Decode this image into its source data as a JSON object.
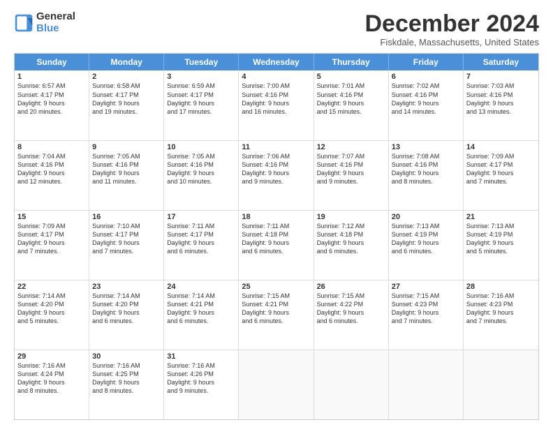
{
  "logo": {
    "general": "General",
    "blue": "Blue"
  },
  "title": "December 2024",
  "location": "Fiskdale, Massachusetts, United States",
  "headers": [
    "Sunday",
    "Monday",
    "Tuesday",
    "Wednesday",
    "Thursday",
    "Friday",
    "Saturday"
  ],
  "weeks": [
    [
      {
        "day": "1",
        "lines": [
          "Sunrise: 6:57 AM",
          "Sunset: 4:17 PM",
          "Daylight: 9 hours",
          "and 20 minutes."
        ]
      },
      {
        "day": "2",
        "lines": [
          "Sunrise: 6:58 AM",
          "Sunset: 4:17 PM",
          "Daylight: 9 hours",
          "and 19 minutes."
        ]
      },
      {
        "day": "3",
        "lines": [
          "Sunrise: 6:59 AM",
          "Sunset: 4:17 PM",
          "Daylight: 9 hours",
          "and 17 minutes."
        ]
      },
      {
        "day": "4",
        "lines": [
          "Sunrise: 7:00 AM",
          "Sunset: 4:16 PM",
          "Daylight: 9 hours",
          "and 16 minutes."
        ]
      },
      {
        "day": "5",
        "lines": [
          "Sunrise: 7:01 AM",
          "Sunset: 4:16 PM",
          "Daylight: 9 hours",
          "and 15 minutes."
        ]
      },
      {
        "day": "6",
        "lines": [
          "Sunrise: 7:02 AM",
          "Sunset: 4:16 PM",
          "Daylight: 9 hours",
          "and 14 minutes."
        ]
      },
      {
        "day": "7",
        "lines": [
          "Sunrise: 7:03 AM",
          "Sunset: 4:16 PM",
          "Daylight: 9 hours",
          "and 13 minutes."
        ]
      }
    ],
    [
      {
        "day": "8",
        "lines": [
          "Sunrise: 7:04 AM",
          "Sunset: 4:16 PM",
          "Daylight: 9 hours",
          "and 12 minutes."
        ]
      },
      {
        "day": "9",
        "lines": [
          "Sunrise: 7:05 AM",
          "Sunset: 4:16 PM",
          "Daylight: 9 hours",
          "and 11 minutes."
        ]
      },
      {
        "day": "10",
        "lines": [
          "Sunrise: 7:05 AM",
          "Sunset: 4:16 PM",
          "Daylight: 9 hours",
          "and 10 minutes."
        ]
      },
      {
        "day": "11",
        "lines": [
          "Sunrise: 7:06 AM",
          "Sunset: 4:16 PM",
          "Daylight: 9 hours",
          "and 9 minutes."
        ]
      },
      {
        "day": "12",
        "lines": [
          "Sunrise: 7:07 AM",
          "Sunset: 4:16 PM",
          "Daylight: 9 hours",
          "and 9 minutes."
        ]
      },
      {
        "day": "13",
        "lines": [
          "Sunrise: 7:08 AM",
          "Sunset: 4:16 PM",
          "Daylight: 9 hours",
          "and 8 minutes."
        ]
      },
      {
        "day": "14",
        "lines": [
          "Sunrise: 7:09 AM",
          "Sunset: 4:17 PM",
          "Daylight: 9 hours",
          "and 7 minutes."
        ]
      }
    ],
    [
      {
        "day": "15",
        "lines": [
          "Sunrise: 7:09 AM",
          "Sunset: 4:17 PM",
          "Daylight: 9 hours",
          "and 7 minutes."
        ]
      },
      {
        "day": "16",
        "lines": [
          "Sunrise: 7:10 AM",
          "Sunset: 4:17 PM",
          "Daylight: 9 hours",
          "and 7 minutes."
        ]
      },
      {
        "day": "17",
        "lines": [
          "Sunrise: 7:11 AM",
          "Sunset: 4:17 PM",
          "Daylight: 9 hours",
          "and 6 minutes."
        ]
      },
      {
        "day": "18",
        "lines": [
          "Sunrise: 7:11 AM",
          "Sunset: 4:18 PM",
          "Daylight: 9 hours",
          "and 6 minutes."
        ]
      },
      {
        "day": "19",
        "lines": [
          "Sunrise: 7:12 AM",
          "Sunset: 4:18 PM",
          "Daylight: 9 hours",
          "and 6 minutes."
        ]
      },
      {
        "day": "20",
        "lines": [
          "Sunrise: 7:13 AM",
          "Sunset: 4:19 PM",
          "Daylight: 9 hours",
          "and 6 minutes."
        ]
      },
      {
        "day": "21",
        "lines": [
          "Sunrise: 7:13 AM",
          "Sunset: 4:19 PM",
          "Daylight: 9 hours",
          "and 5 minutes."
        ]
      }
    ],
    [
      {
        "day": "22",
        "lines": [
          "Sunrise: 7:14 AM",
          "Sunset: 4:20 PM",
          "Daylight: 9 hours",
          "and 5 minutes."
        ]
      },
      {
        "day": "23",
        "lines": [
          "Sunrise: 7:14 AM",
          "Sunset: 4:20 PM",
          "Daylight: 9 hours",
          "and 6 minutes."
        ]
      },
      {
        "day": "24",
        "lines": [
          "Sunrise: 7:14 AM",
          "Sunset: 4:21 PM",
          "Daylight: 9 hours",
          "and 6 minutes."
        ]
      },
      {
        "day": "25",
        "lines": [
          "Sunrise: 7:15 AM",
          "Sunset: 4:21 PM",
          "Daylight: 9 hours",
          "and 6 minutes."
        ]
      },
      {
        "day": "26",
        "lines": [
          "Sunrise: 7:15 AM",
          "Sunset: 4:22 PM",
          "Daylight: 9 hours",
          "and 6 minutes."
        ]
      },
      {
        "day": "27",
        "lines": [
          "Sunrise: 7:15 AM",
          "Sunset: 4:23 PM",
          "Daylight: 9 hours",
          "and 7 minutes."
        ]
      },
      {
        "day": "28",
        "lines": [
          "Sunrise: 7:16 AM",
          "Sunset: 4:23 PM",
          "Daylight: 9 hours",
          "and 7 minutes."
        ]
      }
    ],
    [
      {
        "day": "29",
        "lines": [
          "Sunrise: 7:16 AM",
          "Sunset: 4:24 PM",
          "Daylight: 9 hours",
          "and 8 minutes."
        ]
      },
      {
        "day": "30",
        "lines": [
          "Sunrise: 7:16 AM",
          "Sunset: 4:25 PM",
          "Daylight: 9 hours",
          "and 8 minutes."
        ]
      },
      {
        "day": "31",
        "lines": [
          "Sunrise: 7:16 AM",
          "Sunset: 4:26 PM",
          "Daylight: 9 hours",
          "and 9 minutes."
        ]
      },
      {
        "day": "",
        "lines": []
      },
      {
        "day": "",
        "lines": []
      },
      {
        "day": "",
        "lines": []
      },
      {
        "day": "",
        "lines": []
      }
    ]
  ]
}
